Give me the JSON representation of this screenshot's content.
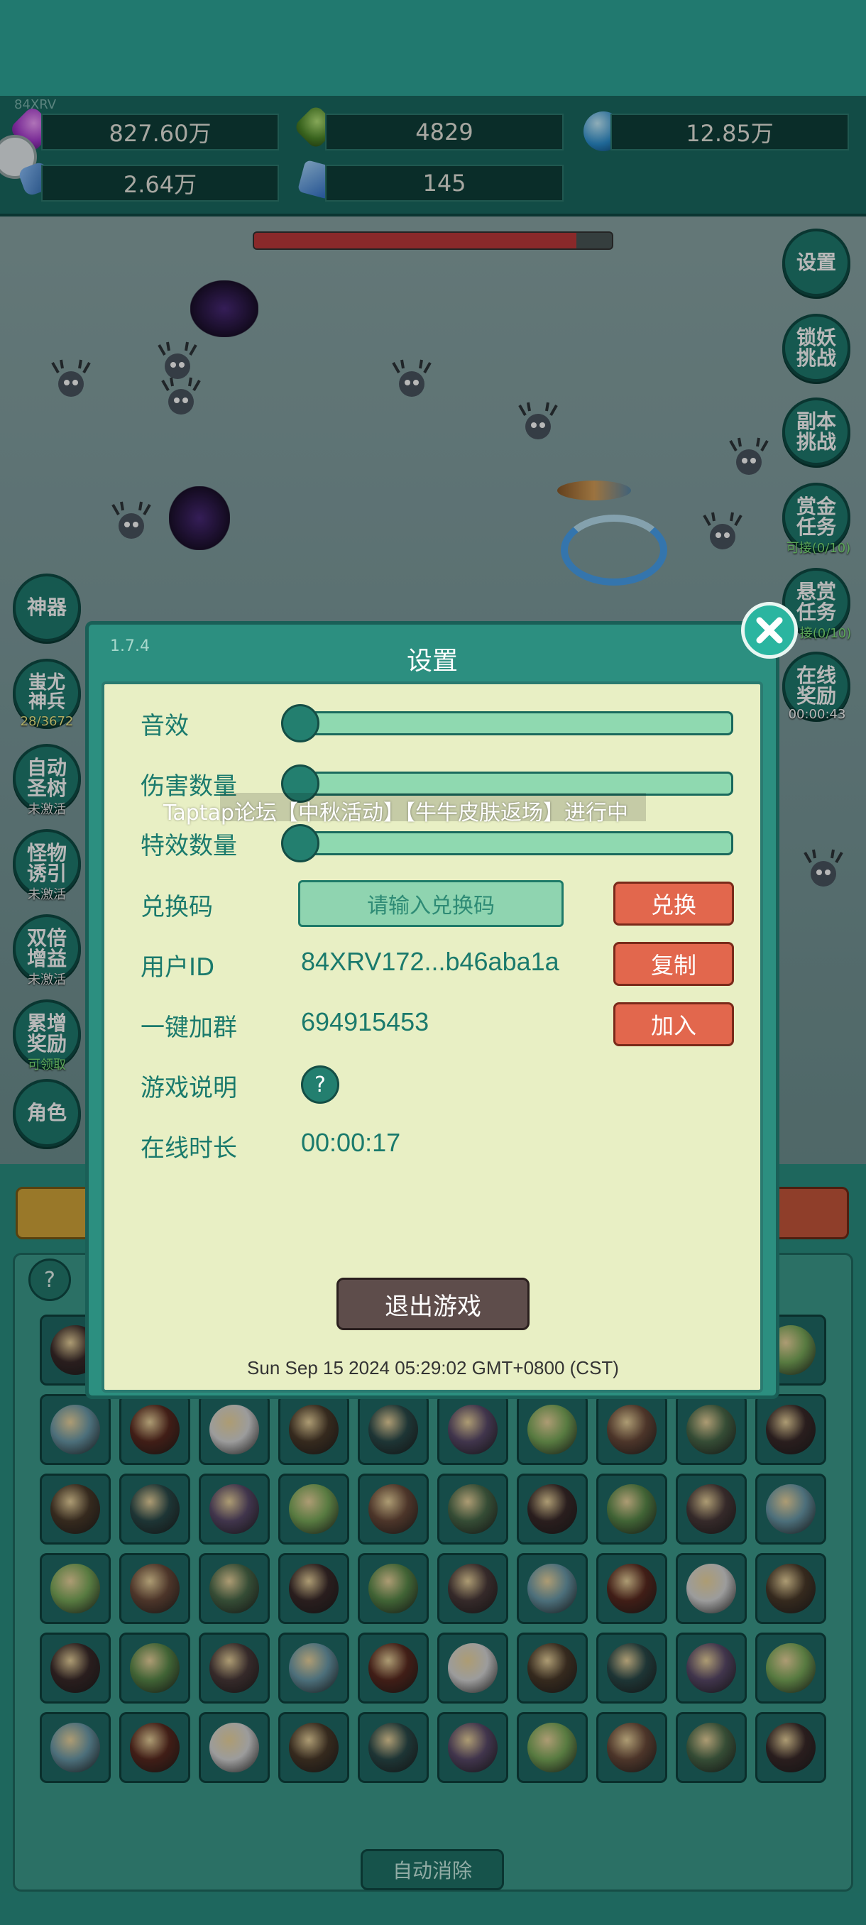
{
  "version": "1.7.4",
  "top_version_tag": "84XRV",
  "resources": {
    "gold": "827.60万",
    "gem": "4829",
    "orb": "12.85万",
    "card": "2.64万",
    "crystal": "145"
  },
  "boss_hp_fraction": 0.9,
  "side_left": [
    {
      "label": "神器",
      "sub": ""
    },
    {
      "label": "蚩尤\n神兵",
      "sub": "28/3672"
    },
    {
      "label": "自动\n圣树",
      "sub": "未激活"
    },
    {
      "label": "怪物\n诱引",
      "sub": "未激活"
    },
    {
      "label": "双倍\n增益",
      "sub": "未激活"
    },
    {
      "label": "累增\n奖励",
      "sub": "可领取"
    },
    {
      "label": "角色",
      "sub": ""
    }
  ],
  "side_right": [
    {
      "label": "设置",
      "sub": ""
    },
    {
      "label": "锁妖\n挑战",
      "sub": ""
    },
    {
      "label": "副本\n挑战",
      "sub": ""
    },
    {
      "label": "赏金\n任务",
      "sub": "可接(0/10)"
    },
    {
      "label": "悬赏\n任务",
      "sub": "接(0/10)"
    },
    {
      "label": "在线\n奖励",
      "sub": "00:00:43"
    }
  ],
  "dialog": {
    "title": "设置",
    "rows": {
      "sound_label": "音效",
      "damage_label": "伤害数量",
      "effect_label": "特效数量",
      "redeem_label": "兑换码",
      "redeem_placeholder": "请输入兑换码",
      "redeem_button": "兑换",
      "userid_label": "用户ID",
      "userid_value": "84XRV172...b46aba1a",
      "copy_button": "复制",
      "group_label": "一键加群",
      "group_value": "694915453",
      "join_button": "加入",
      "guide_label": "游戏说明",
      "guide_icon": "?",
      "online_label": "在线时长",
      "online_value": "00:00:17"
    },
    "sliders": {
      "sound": 0,
      "damage": 0,
      "effect": 0
    },
    "exit_button": "退出游戏",
    "timestamp": "Sun Sep 15 2024 05:29:02 GMT+0800 (CST)"
  },
  "marquee": "Taptap论坛【中秋活动】【牛牛皮肤返场】进行中",
  "bottom": {
    "help_icon": "?",
    "auto_clear": "自动消除"
  },
  "colors": {
    "accent": "#2c8f80",
    "panel": "#e8efc4",
    "red_button": "#e2674d",
    "label": "#1a7a6c"
  }
}
